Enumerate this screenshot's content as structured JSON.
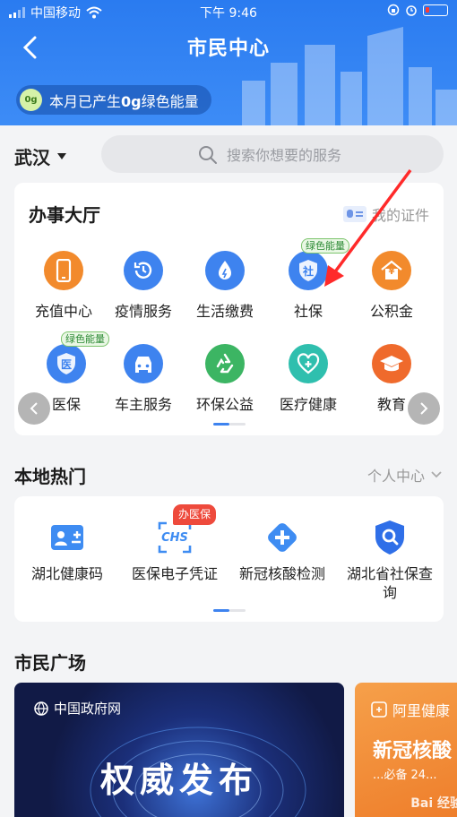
{
  "status_bar": {
    "carrier": "中国移动",
    "time": "下午 9:46"
  },
  "header": {
    "title": "市民中心",
    "energy_text_pre": "本月已产生",
    "energy_value": "0g",
    "energy_text_post": "绿色能量",
    "energy_dot": "0g"
  },
  "search": {
    "city": "武汉",
    "placeholder": "搜索你想要的服务"
  },
  "hall": {
    "title": "办事大厅",
    "cert_label": "我的证件",
    "items": [
      {
        "label": "充值中心",
        "icon": "phone-icon",
        "color": "#f28a2c"
      },
      {
        "label": "疫情服务",
        "icon": "clock-history-icon",
        "color": "#3e83ef"
      },
      {
        "label": "生活缴费",
        "icon": "drop-icon",
        "color": "#3e83ef"
      },
      {
        "label": "社保",
        "icon": "shield-she-icon",
        "color": "#3e83ef",
        "badge": "绿色能量"
      },
      {
        "label": "公积金",
        "icon": "house-yen-icon",
        "color": "#f28a2c"
      },
      {
        "label": "医保",
        "icon": "shield-yi-icon",
        "color": "#3e83ef",
        "badge": "绿色能量"
      },
      {
        "label": "车主服务",
        "icon": "car-icon",
        "color": "#3e83ef"
      },
      {
        "label": "环保公益",
        "icon": "recycle-icon",
        "color": "#3cb563"
      },
      {
        "label": "医疗健康",
        "icon": "medical-icon",
        "color": "#2fbfae"
      },
      {
        "label": "教育",
        "icon": "graduation-cap-icon",
        "color": "#ef6a2c"
      }
    ],
    "she_char": "社",
    "yi_char": "医",
    "yen_char": "¥"
  },
  "hot": {
    "title": "本地热门",
    "personal_label": "个人中心",
    "items": [
      {
        "label": "湖北健康码",
        "icon": "health-code-icon"
      },
      {
        "label": "医保电子凭证",
        "icon": "chs-icon",
        "badge": "办医保",
        "icon_text": "CHS"
      },
      {
        "label": "新冠核酸检测",
        "icon": "plus-diamond-icon"
      },
      {
        "label": "湖北省社保查询",
        "icon": "shield-search-icon"
      }
    ]
  },
  "plaza": {
    "title": "市民广场",
    "card1": {
      "source": "中国政府网",
      "headline": "权威发布"
    },
    "card2": {
      "source": "阿里健康",
      "headline": "新冠核酸",
      "sub": "...必备 24..."
    },
    "watermark": "Bai 经验"
  },
  "colors": {
    "brand_blue": "#2f80f2",
    "annotation_red": "#ff2a2a"
  }
}
